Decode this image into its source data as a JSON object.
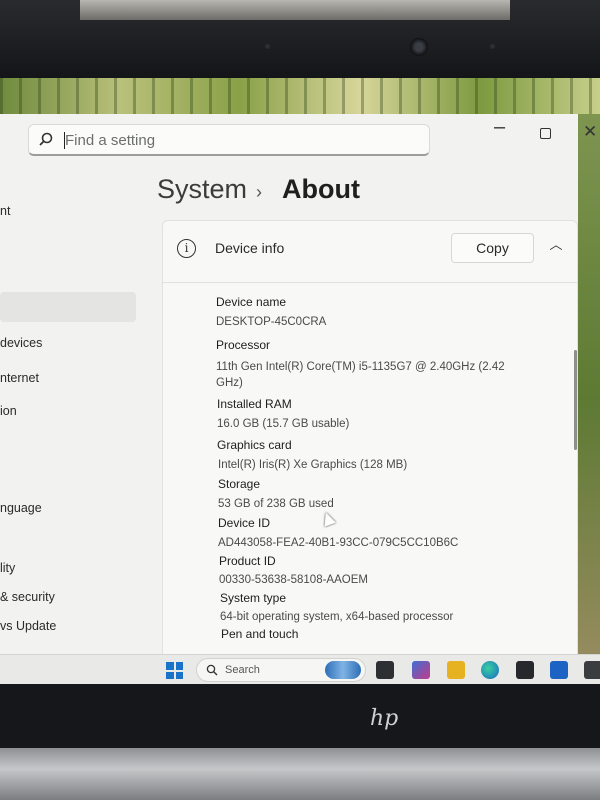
{
  "search": {
    "placeholder": "Find a setting"
  },
  "sidebar": {
    "items": [
      {
        "label": "nt"
      },
      {
        "label": "devices"
      },
      {
        "label": "nternet"
      },
      {
        "label": "ion"
      },
      {
        "label": "nguage"
      },
      {
        "label": "lity"
      },
      {
        "label": "& security"
      },
      {
        "label": "vs Update"
      }
    ]
  },
  "breadcrumb": {
    "parent": "System",
    "separator": "›",
    "current": "About"
  },
  "device_info": {
    "title": "Device info",
    "copy_label": "Copy",
    "specs": [
      {
        "label": "Device name",
        "value": "DESKTOP-45C0CRA"
      },
      {
        "label": "Processor",
        "value": "11th Gen Intel(R) Core(TM) i5-1135G7 @ 2.40GHz (2.42",
        "value_cont": "GHz)"
      },
      {
        "label": "Installed RAM",
        "value": "16.0 GB (15.7 GB usable)"
      },
      {
        "label": "Graphics card",
        "value": "Intel(R) Iris(R) Xe Graphics (128 MB)"
      },
      {
        "label": "Storage",
        "value": "53 GB of 238 GB used"
      },
      {
        "label": "Device ID",
        "value": "AD443058-FEA2-40B1-93CC-079C5CC10B6C"
      },
      {
        "label": "Product ID",
        "value": "00330-53638-58108-AAOEM"
      },
      {
        "label": "System type",
        "value": "64-bit operating system, x64-based processor"
      },
      {
        "label": "Pen and touch",
        "value": ""
      }
    ]
  },
  "taskbar": {
    "search_label": "Search"
  },
  "colors": {
    "accent": "#1a73c9",
    "window_bg": "#f2f3f0",
    "card_bg": "#f8f8f6"
  }
}
